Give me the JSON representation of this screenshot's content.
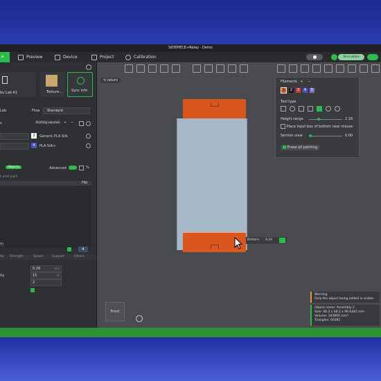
{
  "window": {
    "title": "SIDEPIECE+Relay - Demo"
  },
  "tabs": {
    "prepare": "e",
    "preview": "Preview",
    "device": "Device",
    "project": "Project",
    "calibration": "Calibration"
  },
  "topright": {
    "slice_label": "Slice plate"
  },
  "sidebar": {
    "printer": "bu Lab A1",
    "texture": "Texture...",
    "sync": "Sync info",
    "plate_label": "Lab",
    "flow_label": "Flow",
    "flow_value": "Standard",
    "painting_label": "Painting volumes",
    "filament_rows": [
      {
        "num": "2",
        "name": "Generic PLA Silk"
      },
      {
        "num": "4",
        "name": "PLA Silk+"
      }
    ],
    "objects_tag": "Objects",
    "advanced_label": "Advanced",
    "parts_hint": "t and part",
    "file_label": "File",
    "list_items": [
      "",
      "",
      "",
      ""
    ],
    "list_bottom": "Y)",
    "counter": "4",
    "settings_tabs": [
      "ity",
      "Strength",
      "Speed",
      "Support",
      "Others"
    ],
    "layer_height": "0.28",
    "unit_mm": "mm",
    "quality_label": "ity",
    "quality_value": "15",
    "percent": "%",
    "walls_value": "2"
  },
  "viewport": {
    "return_label": "return",
    "bottom_label": "Bottom:",
    "bottom_value": "9.24",
    "front_label": "Front"
  },
  "paint_panel": {
    "filaments_label": "Filaments",
    "filament_numbers": [
      "1",
      "2",
      "3",
      "4",
      "5"
    ],
    "filament_colors": [
      "#d9571f",
      "#1e1e1e",
      "#d0392e",
      "#4a52c8",
      "#8b6bd8"
    ],
    "tool_type_label": "Tool type",
    "height_range_label": "Height range",
    "height_value": "2.18",
    "place_label": "Place input box of bottom near mouse",
    "section_label": "Section view",
    "section_value": "0.00",
    "erase_label": "Erase all painting"
  },
  "messages": {
    "warning_title": "Warning",
    "warning_text": "Only the object being edited is visible.",
    "object_name": "Object name: Assembly 2",
    "size": "Size: 48.2 x 48.2 x 96.6442 mm",
    "volume": "Volume: 193892 mm³",
    "triangles": "Triangles: 60392"
  },
  "colors": {
    "accent": "#2dbb4c",
    "orange": "#d9571f",
    "cylinder": "#a6b8c8"
  }
}
